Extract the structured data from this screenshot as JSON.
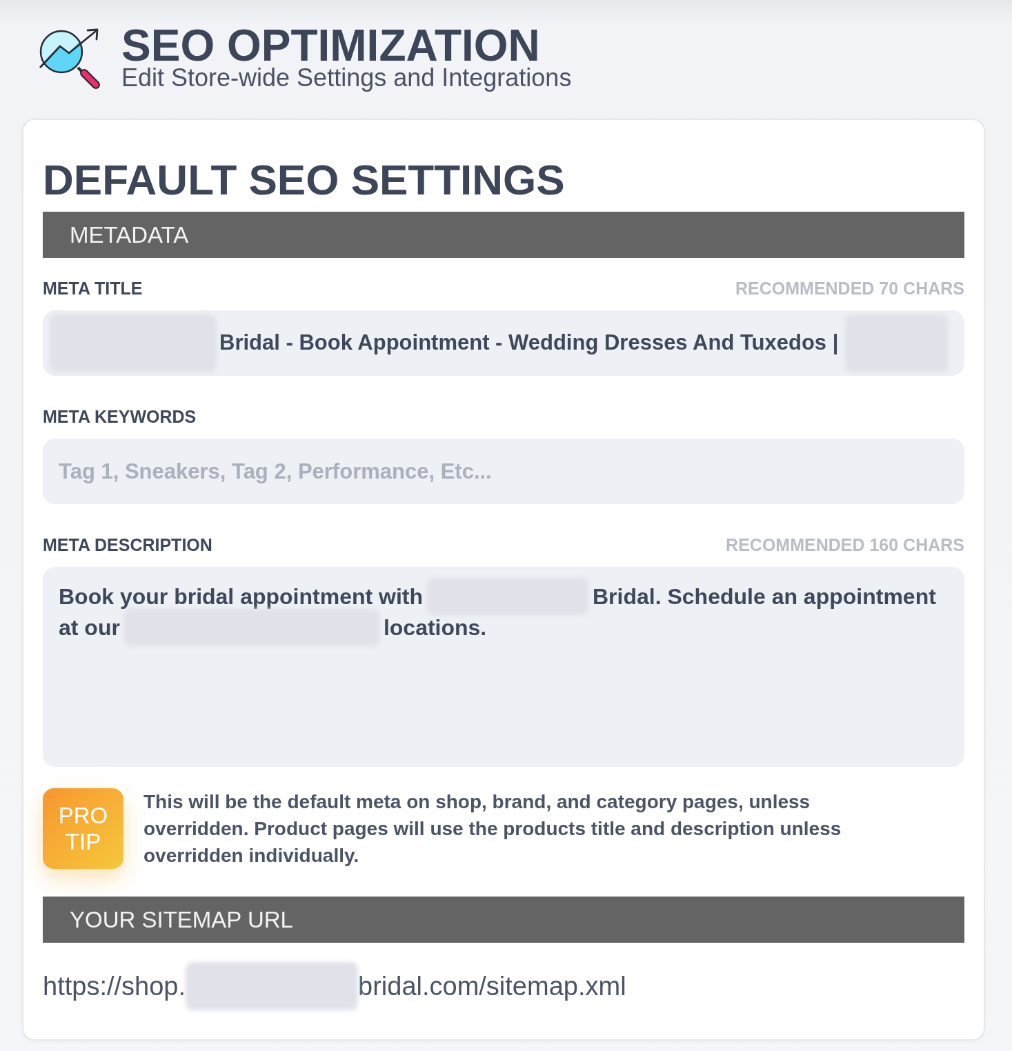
{
  "header": {
    "title": "SEO OPTIMIZATION",
    "subtitle": "Edit Store-wide Settings and Integrations"
  },
  "settings": {
    "title": "DEFAULT SEO SETTINGS",
    "metadata": {
      "heading": "METADATA",
      "fields": [
        {
          "kind": "single",
          "label": "META TITLE",
          "hint": "RECOMMENDED 70 CHARS",
          "value": [
            {
              "kind": "redacted"
            },
            {
              "kind": "text",
              "text": "Bridal - Book Appointment - Wedding Dresses And Tuxedos |"
            },
            {
              "kind": "redacted"
            }
          ]
        },
        {
          "kind": "empty",
          "label": "META KEYWORDS",
          "placeholder": "Tag 1, Sneakers, Tag 2, Performance, Etc..."
        },
        {
          "kind": "multi",
          "label": "META DESCRIPTION",
          "hint": "RECOMMENDED 160 CHARS",
          "lines": [
            [
              {
                "kind": "text",
                "text": "Book your bridal appointment with"
              },
              {
                "kind": "redacted"
              },
              {
                "kind": "text",
                "text": "Bridal. Schedule an appointment"
              }
            ],
            [
              {
                "kind": "text",
                "text": "at our"
              },
              {
                "kind": "redacted"
              },
              {
                "kind": "text",
                "text": "locations."
              }
            ]
          ]
        }
      ]
    },
    "pro_tip": {
      "badge": "PRO TIP",
      "text": "This will be the default meta on shop, brand, and category pages, unless overridden. Product pages will use the products title and description unless overridden individually."
    },
    "sitemap": {
      "heading": "YOUR SITEMAP URL",
      "url": [
        {
          "kind": "text",
          "text": "https://shop."
        },
        {
          "kind": "redacted"
        },
        {
          "kind": "text",
          "text": "bridal.com/sitemap.xml"
        }
      ]
    }
  }
}
